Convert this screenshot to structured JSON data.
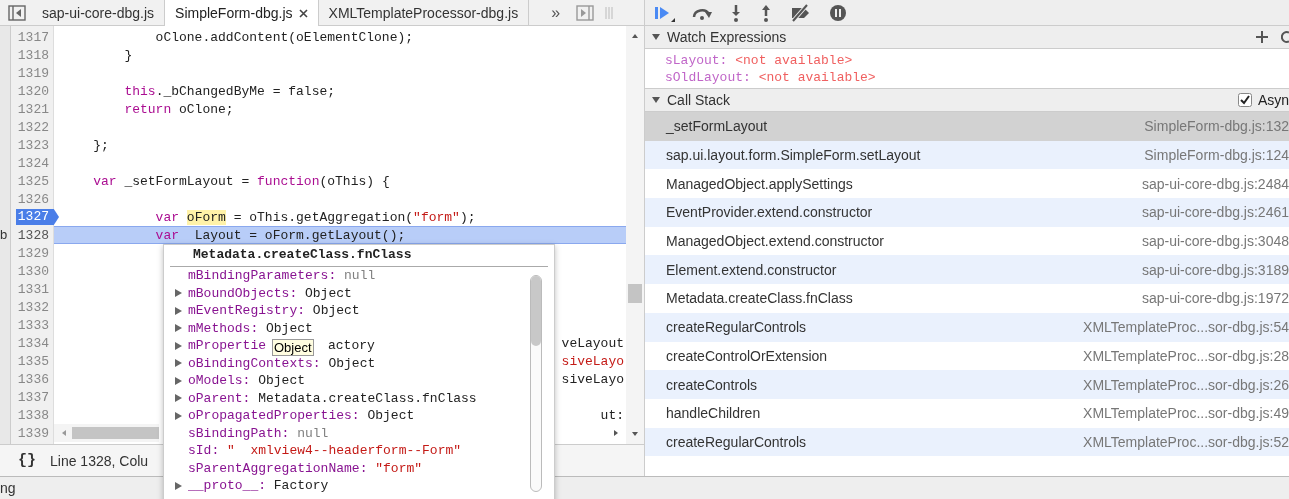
{
  "editor": {
    "tabs": [
      {
        "label": "sap-ui-core-dbg.js",
        "selected": false,
        "closable": false
      },
      {
        "label": "SimpleForm-dbg.js",
        "selected": true,
        "closable": true
      },
      {
        "label": "XMLTemplateProcessor-dbg.js",
        "selected": false,
        "closable": false
      }
    ],
    "overflow": "»",
    "side_text": "b",
    "lines": [
      {
        "number": "1317",
        "current": false,
        "breakpoint": false,
        "tokens": [
          {
            "kind": "plain",
            "t": "            oClone.addContent(oElementClone);"
          }
        ]
      },
      {
        "number": "1318",
        "current": false,
        "breakpoint": false,
        "tokens": [
          {
            "kind": "plain",
            "t": "        }"
          }
        ]
      },
      {
        "number": "1319",
        "current": false,
        "breakpoint": false
      },
      {
        "number": "1320",
        "current": false,
        "breakpoint": false,
        "tokens": [
          {
            "kind": "keyword",
            "t": "        this"
          },
          {
            "kind": "plain",
            "t": "._bChangedByMe = false;"
          }
        ]
      },
      {
        "number": "1321",
        "current": false,
        "breakpoint": false,
        "tokens": [
          {
            "kind": "keyword",
            "t": "        return"
          },
          {
            "kind": "plain",
            "t": " oClone;"
          }
        ]
      },
      {
        "number": "1322",
        "current": false,
        "breakpoint": false
      },
      {
        "number": "1323",
        "current": false,
        "breakpoint": false,
        "tokens": [
          {
            "kind": "plain",
            "t": "    };"
          }
        ]
      },
      {
        "number": "1324",
        "current": false,
        "breakpoint": false
      },
      {
        "number": "1325",
        "current": false,
        "breakpoint": false,
        "tokens": [
          {
            "kind": "keyword",
            "t": "    var"
          },
          {
            "kind": "plain",
            "t": " _setFormLayout = "
          },
          {
            "kind": "keyword",
            "t": "function"
          },
          {
            "kind": "plain",
            "t": "(oThis) {"
          }
        ]
      },
      {
        "number": "1326",
        "current": false,
        "breakpoint": false
      },
      {
        "number": "1327",
        "current": false,
        "breakpoint": true,
        "tokens": [
          {
            "kind": "keyword",
            "t": "            var"
          },
          {
            "kind": "match",
            "t": " oForm"
          },
          {
            "kind": "plain",
            "t": " = oThis.getAggregation("
          },
          {
            "kind": "string",
            "t": "\"form\""
          },
          {
            "kind": "plain",
            "t": ");"
          }
        ]
      },
      {
        "number": "1328",
        "current": true,
        "breakpoint": false,
        "tokens": [
          {
            "kind": "keyword",
            "t": "            var"
          },
          {
            "kind": "plain",
            "t": "  Layout = oForm.getLayout();"
          }
        ]
      },
      {
        "number": "1329",
        "current": false,
        "breakpoint": false
      },
      {
        "number": "1330",
        "current": false,
        "breakpoint": false
      },
      {
        "number": "1331",
        "current": false,
        "breakpoint": false
      },
      {
        "number": "1332",
        "current": false,
        "breakpoint": false
      },
      {
        "number": "1333",
        "current": false,
        "breakpoint": false
      },
      {
        "number": "1334",
        "current": false,
        "breakpoint": false,
        "tail": {
          "kind": "plain",
          "t": "veLayout"
        }
      },
      {
        "number": "1335",
        "current": false,
        "breakpoint": false,
        "tail": {
          "kind": "string",
          "t": "siveLayo"
        }
      },
      {
        "number": "1336",
        "current": false,
        "breakpoint": false,
        "tail": {
          "kind": "plain",
          "t": "siveLayo"
        }
      },
      {
        "number": "1337",
        "current": false,
        "breakpoint": false
      },
      {
        "number": "1338",
        "current": false,
        "breakpoint": false,
        "tail": {
          "kind": "plain",
          "t": "ut:"
        }
      },
      {
        "number": "1339",
        "current": false,
        "breakpoint": false
      }
    ],
    "format_button": "{}",
    "status": "Line 1328, Colu",
    "drawer_text": "ng"
  },
  "popover": {
    "title": "Metadata.createClass.fnClass",
    "properties": [
      {
        "expandable": false,
        "name": "mBindingParameters:",
        "value": "null",
        "kind": "null"
      },
      {
        "expandable": true,
        "name": "mBoundObjects:",
        "value": "Object",
        "kind": "object"
      },
      {
        "expandable": true,
        "name": "mEventRegistry:",
        "value": "Object",
        "kind": "object"
      },
      {
        "expandable": true,
        "name": "mMethods:",
        "value": "Object",
        "kind": "object"
      },
      {
        "expandable": true,
        "name": "mPropertie",
        "value": "actory",
        "kind": "object",
        "tooltip": "Object"
      },
      {
        "expandable": true,
        "name": "oBindingContexts:",
        "value": "Object",
        "kind": "object"
      },
      {
        "expandable": true,
        "name": "oModels:",
        "value": "Object",
        "kind": "object"
      },
      {
        "expandable": true,
        "name": "oParent:",
        "value": "Metadata.createClass.fnClass",
        "kind": "object"
      },
      {
        "expandable": true,
        "name": "oPropagatedProperties:",
        "value": "Object",
        "kind": "object"
      },
      {
        "expandable": false,
        "name": "sBindingPath:",
        "value": "null",
        "kind": "null"
      },
      {
        "expandable": false,
        "name": "sId:",
        "value": "\"  xmlview4--headerform--Form\"",
        "kind": "string"
      },
      {
        "expandable": false,
        "name": "sParentAggregationName:",
        "value": "\"form\"",
        "kind": "string"
      },
      {
        "expandable": true,
        "name": "__proto__:",
        "value": "Factory",
        "kind": "object"
      }
    ]
  },
  "sidebar": {
    "watch": {
      "title": "Watch Expressions",
      "expanded": true,
      "items": [
        {
          "name": "sLayout:",
          "value": "<not available>"
        },
        {
          "name": "sOldLayout:",
          "value": "<not available>"
        }
      ]
    },
    "call_stack": {
      "title": "Call Stack",
      "expanded": true,
      "async_label": "Asyn",
      "async_checked": true,
      "frames": [
        {
          "name": "_setFormLayout",
          "location": "SimpleForm-dbg.js:132",
          "selected": true
        },
        {
          "name": "sap.ui.layout.form.SimpleForm.setLayout",
          "location": "SimpleForm-dbg.js:124",
          "selected": false
        },
        {
          "name": "ManagedObject.applySettings",
          "location": "sap-ui-core-dbg.js:2484",
          "selected": false
        },
        {
          "name": "EventProvider.extend.constructor",
          "location": "sap-ui-core-dbg.js:2461",
          "selected": false
        },
        {
          "name": "ManagedObject.extend.constructor",
          "location": "sap-ui-core-dbg.js:3048",
          "selected": false
        },
        {
          "name": "Element.extend.constructor",
          "location": "sap-ui-core-dbg.js:3189",
          "selected": false
        },
        {
          "name": "Metadata.createClass.fnClass",
          "location": "sap-ui-core-dbg.js:1972",
          "selected": false
        },
        {
          "name": "createRegularControls",
          "location": "XMLTemplateProc...sor-dbg.js:54",
          "selected": false
        },
        {
          "name": "createControlOrExtension",
          "location": "XMLTemplateProc...sor-dbg.js:28",
          "selected": false
        },
        {
          "name": "createControls",
          "location": "XMLTemplateProc...sor-dbg.js:26",
          "selected": false
        },
        {
          "name": "handleChildren",
          "location": "XMLTemplateProc...sor-dbg.js:49",
          "selected": false
        },
        {
          "name": "createRegularControls",
          "location": "XMLTemplateProc...sor-dbg.js:52",
          "selected": false
        }
      ]
    }
  }
}
